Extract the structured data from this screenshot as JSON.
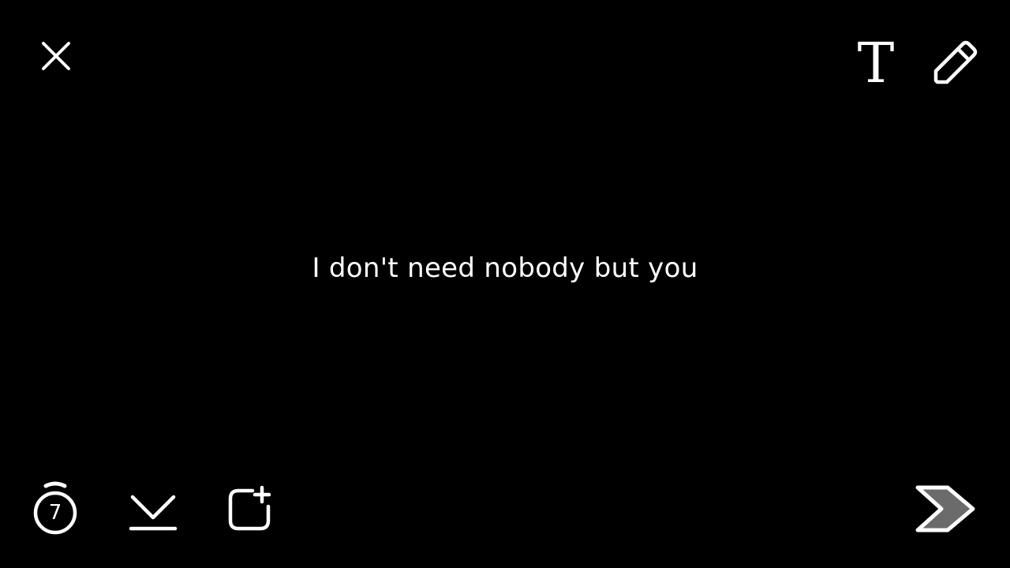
{
  "toolbar_top": {
    "close_icon": "close-icon",
    "text_tool_label": "T",
    "pencil_icon": "pencil-icon"
  },
  "caption": {
    "text": "I don't need nobody but you"
  },
  "toolbar_bottom": {
    "timer_icon": "stopwatch-icon",
    "timer_value": "7",
    "save_icon": "download-icon",
    "story_icon": "add-to-story-icon",
    "send_icon": "send-arrow-icon"
  },
  "colors": {
    "background": "#000000",
    "foreground": "#ffffff",
    "send_fill": "#6b6b6b"
  }
}
